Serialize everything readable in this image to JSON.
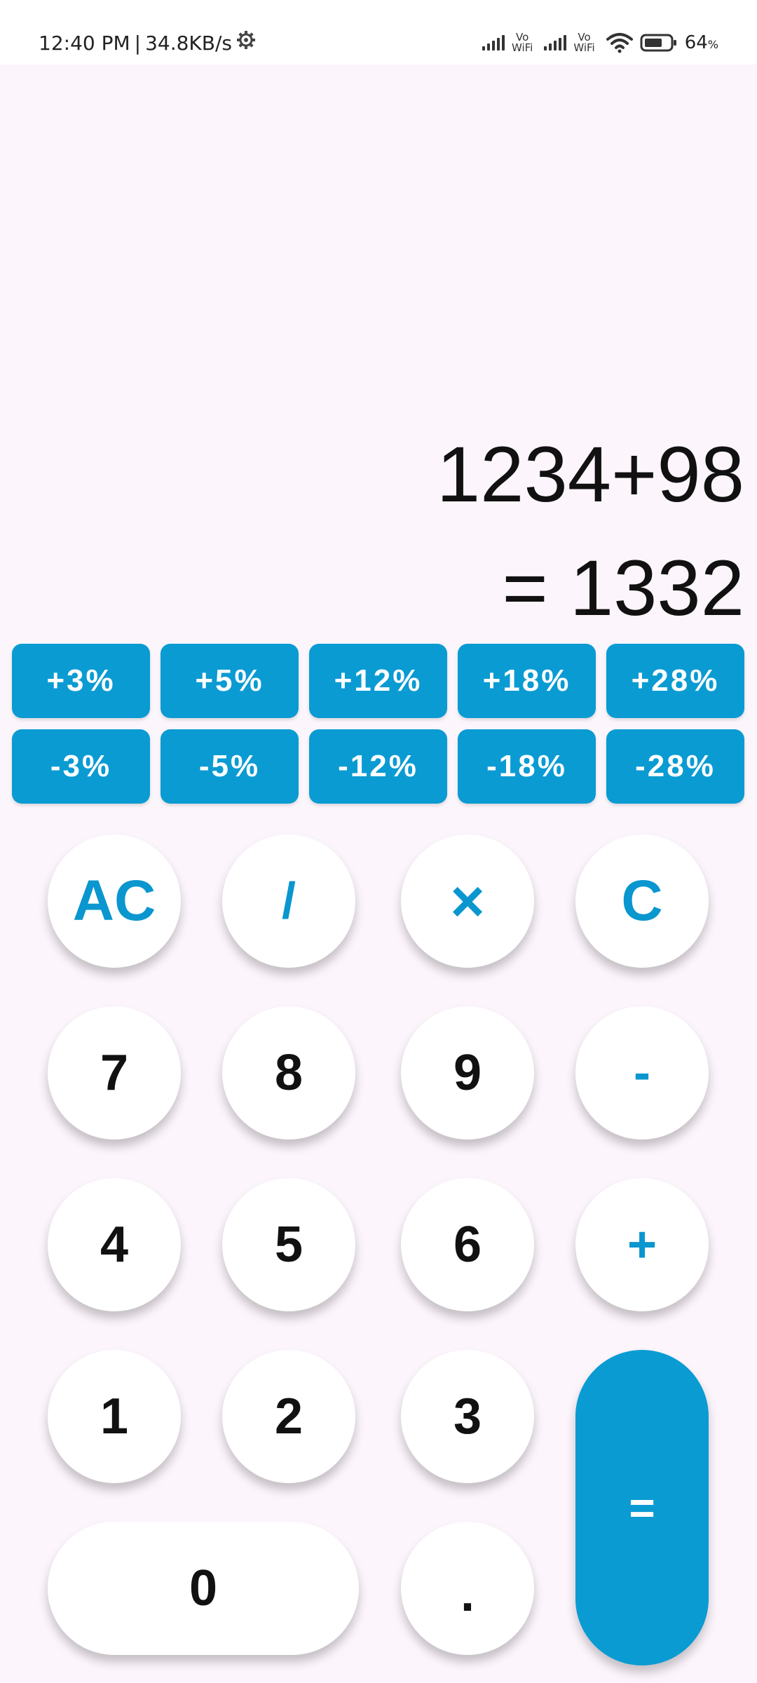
{
  "status_bar": {
    "time": "12:40 PM",
    "separator": "|",
    "speed": "34.8KB/s",
    "sim1_label_top": "Vo",
    "sim1_label_bottom": "WiFi",
    "sim2_label_top": "Vo",
    "sim2_label_bottom": "WiFi",
    "battery_value": "64",
    "battery_unit": "%"
  },
  "display": {
    "expression": "1234+98",
    "result": "= 1332"
  },
  "percent_plus": [
    "+3%",
    "+5%",
    "+12%",
    "+18%",
    "+28%"
  ],
  "percent_minus": [
    "-3%",
    "-5%",
    "-12%",
    "-18%",
    "-28%"
  ],
  "keys": {
    "ac": "AC",
    "divide": "/",
    "multiply": "×",
    "clear": "C",
    "seven": "7",
    "eight": "8",
    "nine": "9",
    "minus": "-",
    "four": "4",
    "five": "5",
    "six": "6",
    "plus": "+",
    "one": "1",
    "two": "2",
    "three": "3",
    "equals": "=",
    "zero": "0",
    "dot": "."
  },
  "colors": {
    "accent": "#0a9bd3",
    "background": "#fcf5fc",
    "key_background": "#ffffff"
  },
  "icons": {
    "settings": "gear-icon",
    "signal": "signal-strength-icon",
    "wifi": "wifi-icon",
    "battery": "battery-icon"
  }
}
